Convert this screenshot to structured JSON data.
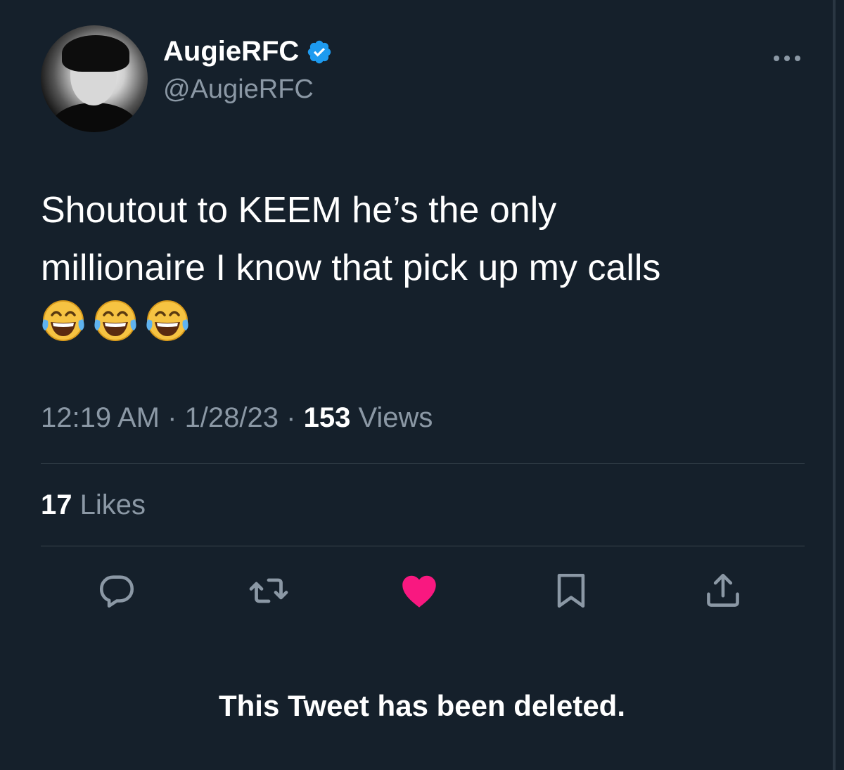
{
  "author": {
    "display_name": "AugieRFC",
    "handle": "@AugieRFC",
    "verified": true
  },
  "tweet": {
    "line1": "Shoutout to KEEM he’s the only",
    "line2": "millionaire I know that pick up my calls",
    "emojis": [
      "face-with-tears-of-joy",
      "face-with-tears-of-joy",
      "face-with-tears-of-joy"
    ]
  },
  "meta": {
    "time": "12:19 AM",
    "separator": " · ",
    "date": "1/28/23",
    "views_count": "153",
    "views_label": " Views"
  },
  "likes": {
    "count": "17",
    "label": " Likes"
  },
  "actions": [
    {
      "icon": "reply-icon"
    },
    {
      "icon": "retweet-icon"
    },
    {
      "icon": "like-icon",
      "active": true
    },
    {
      "icon": "bookmark-icon"
    },
    {
      "icon": "share-icon"
    }
  ],
  "notice": "This Tweet has been deleted.",
  "colors": {
    "background": "#15202b",
    "text_secondary": "#8b98a5",
    "verified": "#1d9bf0",
    "like_active": "#f91880",
    "divider": "#38444d"
  }
}
